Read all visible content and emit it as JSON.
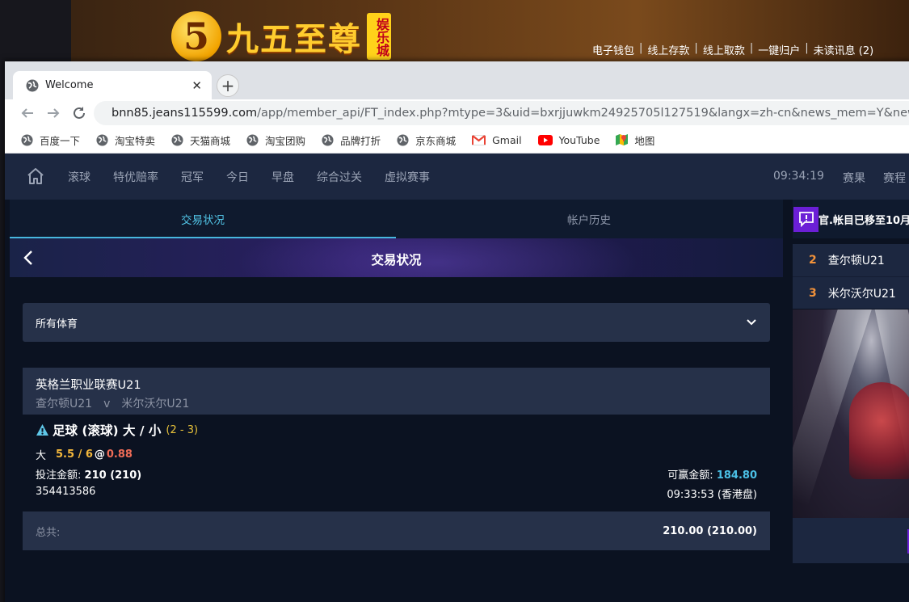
{
  "background_site": {
    "logo_glyph": "5",
    "logo_text": "九五至尊",
    "logo_badge": "娱乐城",
    "top_links": [
      "电子钱包",
      "线上存款",
      "线上取款",
      "一键归户",
      "未读讯息 (2)"
    ]
  },
  "browser": {
    "tab_title": "Welcome",
    "url_host": "bnn85.jeans115599.com",
    "url_rest": "/app/member_api/FT_index.php?mtype=3&uid=bxrjjuwkm24925705l127519&langx=zh-cn&news_mem=Y&news_api=Y",
    "bookmarks": [
      "百度一下",
      "淘宝特卖",
      "天猫商城",
      "淘宝团购",
      "品牌打折",
      "京东商城",
      "Gmail",
      "YouTube",
      "地图"
    ]
  },
  "nav": {
    "items": [
      "滚球",
      "特优赔率",
      "冠军",
      "今日",
      "早盘",
      "综合过关",
      "虚拟赛事"
    ],
    "clock": "09:34:19",
    "right": [
      "赛果",
      "赛程"
    ]
  },
  "tabs": [
    "交易状况",
    "帐户历史"
  ],
  "banner_title": "交易状况",
  "sport_filter": "所有体育",
  "bet": {
    "league": "英格兰职业联赛U21",
    "home": "查尔顿U21",
    "vs": "v",
    "away": "米尔沃尔U21",
    "market": "足球 (滚球) 大 / 小",
    "score": "(2 - 3)",
    "side": "大",
    "handicap": "5.5 / 6",
    "at": "@",
    "odds": "0.88",
    "stake_label": "投注金额:",
    "stake_value": "210 (210)",
    "win_label": "可赢金额:",
    "win_value": "184.80",
    "ticket_id": "354413586",
    "time": "09:33:53 (香港盘)"
  },
  "total": {
    "label": "总共:",
    "value": "210.00 (210.00)"
  },
  "side": {
    "notice": "官.帐目已移至10月",
    "ranks": [
      {
        "num": "2",
        "team": "查尔顿U21"
      },
      {
        "num": "3",
        "team": "米尔沃尔U21"
      }
    ]
  },
  "colors": {
    "accent": "#52c6e8",
    "odds": "#ef6c57",
    "handicap": "#f3b73c",
    "win": "#4bc0e6",
    "purple": "#6b1fd6"
  }
}
